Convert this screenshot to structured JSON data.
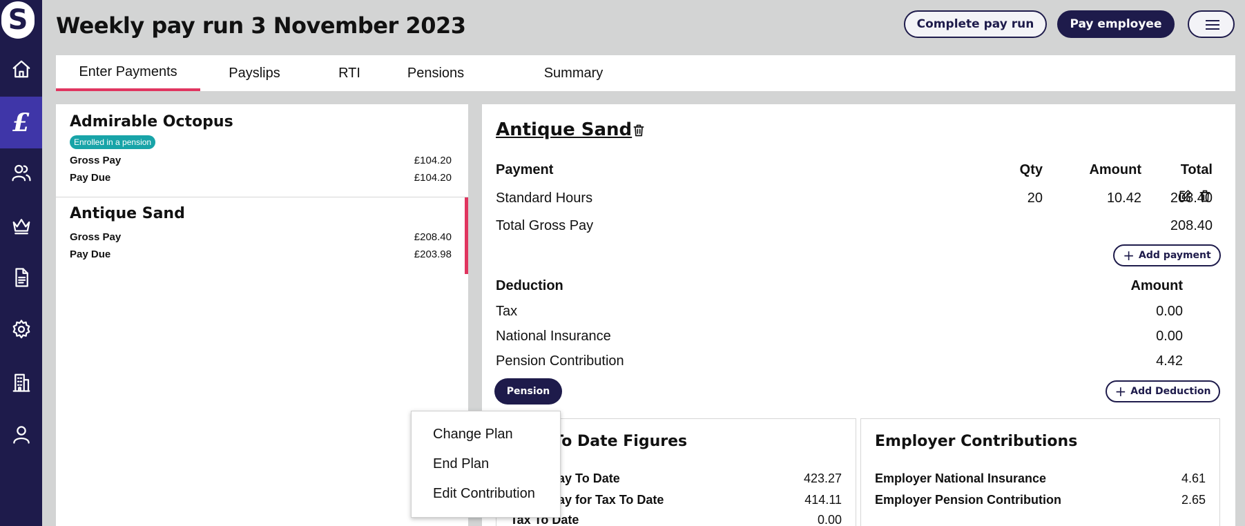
{
  "app": {
    "logo_letter": "S"
  },
  "header": {
    "title": "Weekly pay run 3 November 2023",
    "complete_label": "Complete pay run",
    "pay_label": "Pay employee"
  },
  "sidebar": {
    "items": [
      {
        "name": "home-icon"
      },
      {
        "name": "pound-icon",
        "glyph": "£",
        "active": true
      },
      {
        "name": "people-icon"
      },
      {
        "name": "crown-icon"
      },
      {
        "name": "document-icon"
      },
      {
        "name": "gear-icon"
      },
      {
        "name": "building-icon"
      },
      {
        "name": "user-icon"
      }
    ]
  },
  "tabs": [
    {
      "label": "Enter Payments",
      "active": true
    },
    {
      "label": "Payslips"
    },
    {
      "label": "RTI"
    },
    {
      "label": "Pensions"
    },
    {
      "label": "Summary"
    }
  ],
  "employees": [
    {
      "name": "Admirable Octopus",
      "badge": "Enrolled in a pension",
      "gross_label": "Gross Pay",
      "gross": "£104.20",
      "due_label": "Pay Due",
      "due": "£104.20"
    },
    {
      "name": "Antique Sand",
      "gross_label": "Gross Pay",
      "gross": "£208.40",
      "due_label": "Pay Due",
      "due": "£203.98",
      "selected": true
    }
  ],
  "detail": {
    "name": "Antique Sand",
    "payments": {
      "headers": {
        "payment": "Payment",
        "qty": "Qty",
        "amount": "Amount",
        "total": "Total"
      },
      "rows": [
        {
          "name": "Standard Hours",
          "qty": "20",
          "amount": "10.42",
          "total": "208.40"
        }
      ],
      "total_label": "Total Gross Pay",
      "total_value": "208.40",
      "add_label": "Add payment"
    },
    "deductions": {
      "header": "Deduction",
      "amount_header": "Amount",
      "rows": [
        {
          "name": "Tax",
          "amount": "0.00"
        },
        {
          "name": "National Insurance",
          "amount": "0.00"
        },
        {
          "name": "Pension Contribution",
          "amount": "4.42"
        }
      ],
      "add_label": "Add Deduction",
      "pension_button": "Pension"
    },
    "ytd": {
      "title": "Year To Date Figures",
      "rows": [
        {
          "label": "Gross Pay To Date",
          "value": "423.27"
        },
        {
          "label": "Gross Pay for Tax To Date",
          "value": "414.11"
        },
        {
          "label": "Tax To Date",
          "value": "0.00"
        }
      ]
    },
    "employer": {
      "title": "Employer Contributions",
      "rows": [
        {
          "label": "Employer National Insurance",
          "value": "4.61"
        },
        {
          "label": "Employer Pension Contribution",
          "value": "2.65"
        }
      ]
    }
  },
  "context_menu": {
    "items": [
      "Change Plan",
      "End Plan",
      "Edit Contribution"
    ]
  },
  "colors": {
    "navy": "#1e1b4b",
    "accent": "#e0355f",
    "badge": "#18a4a8",
    "active_nav": "#3f36a8"
  }
}
